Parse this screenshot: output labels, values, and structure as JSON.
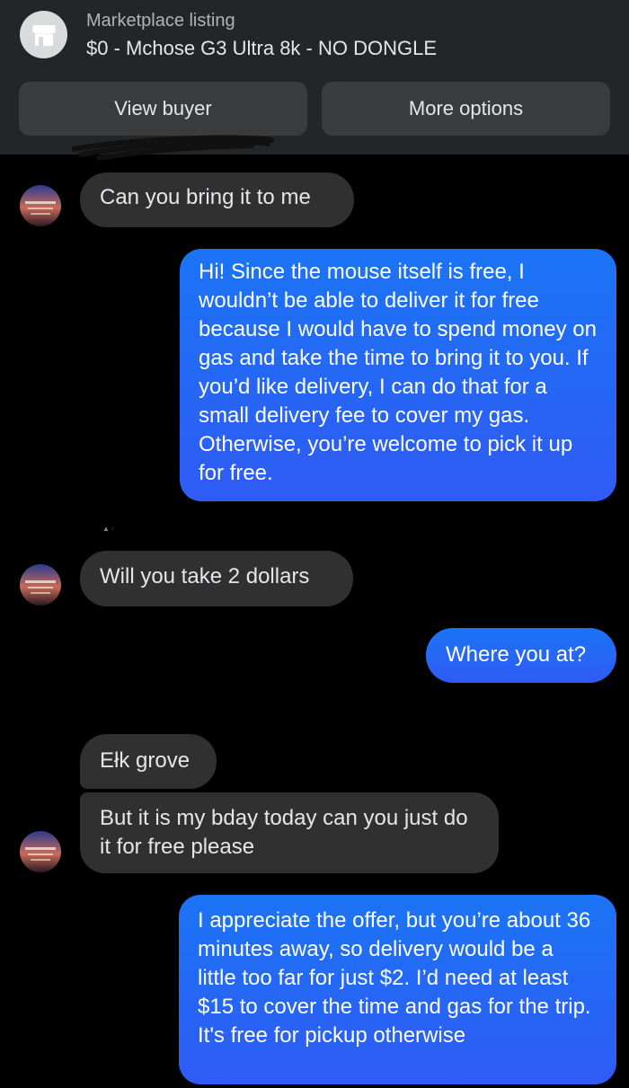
{
  "header": {
    "listing_label": "Marketplace listing",
    "listing_title": "$0 - Mchose G3 Ultra 8k - NO DONGLE",
    "view_buyer": "View buyer",
    "more_options": "More options",
    "shop_icon": "storefront-icon"
  },
  "messages": [
    {
      "from": "buyer",
      "text": "Can you bring it to me"
    },
    {
      "from": "seller",
      "text": "Hi! Since the mouse itself is free, I wouldn’t be able to deliver it for free because I would have to spend money on gas and take the time to bring it to you. If you’d like delivery, I can do that for a small delivery fee to cover my gas. Otherwise, you’re welcome to pick it up for free."
    },
    {
      "from": "buyer",
      "text": "Will you take 2 dollars"
    },
    {
      "from": "seller",
      "text": "Where you at?"
    },
    {
      "from": "buyer",
      "text": "Ełk grove"
    },
    {
      "from": "buyer",
      "text": "But it is my bday today can you just do it for free please"
    },
    {
      "from": "seller",
      "text": "I appreciate the offer, but you’re about 36 minutes away, so delivery would be a little too far for just $2. I’d need at least $15 to cover the time and gas for the trip. It's free for pickup otherwise"
    }
  ],
  "colors": {
    "background": "#000000",
    "header": "#242526",
    "incoming_bubble": "#303030",
    "outgoing_bubble": "#2f5bf5"
  }
}
